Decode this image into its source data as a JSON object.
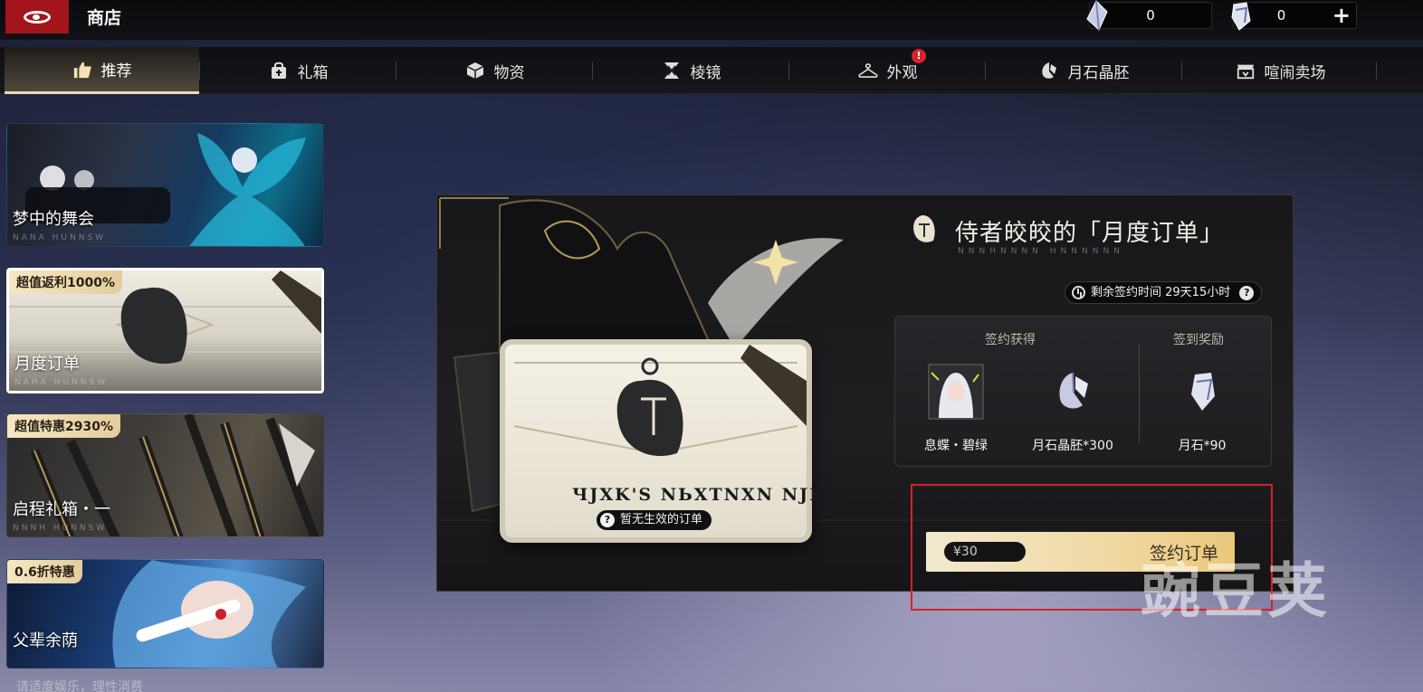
{
  "header": {
    "title": "商店",
    "currency": [
      {
        "icon": "moonstone-embryo-icon",
        "value": "0"
      },
      {
        "icon": "moonstone-icon",
        "value": "0",
        "add_label": "+"
      }
    ]
  },
  "tabs": [
    {
      "label": "推荐",
      "icon": "thumbs-up-icon",
      "active": true
    },
    {
      "label": "礼箱",
      "icon": "gift-bag-icon"
    },
    {
      "label": "物资",
      "icon": "cube-icon"
    },
    {
      "label": "棱镜",
      "icon": "prism-icon"
    },
    {
      "label": "外观",
      "icon": "hanger-icon",
      "badge": "!"
    },
    {
      "label": "月石晶胚",
      "icon": "crystal-icon"
    },
    {
      "label": "喧闹卖场",
      "icon": "market-icon"
    }
  ],
  "sidebar": {
    "items": [
      {
        "name": "梦中的舞会",
        "tag": "",
        "sub": "NANA HUNNSW"
      },
      {
        "name": "月度订单",
        "tag": "超值返利1000%",
        "sub": "NAHA HUNNSW"
      },
      {
        "name": "启程礼箱・一",
        "tag": "超值特惠2930%",
        "sub": "NNNH HUNNSW"
      },
      {
        "name": "父辈余荫",
        "tag": "0.6折特惠",
        "sub": ""
      }
    ],
    "bottom_note": "请适度娱乐，理性消费"
  },
  "panel": {
    "title": "侍者皎皎的「月度订单」",
    "subtitle": "NNNHNNNN HNNNNNN",
    "timer": "剩余签约时间 29天15小时",
    "timer_help": "?",
    "order_card": {
      "cipher": "ЧJXK'S NЬXTNXN NJЬS",
      "status": "暂无生效的订单",
      "status_help": "?"
    },
    "rewards": {
      "sign_label": "签约获得",
      "checkin_label": "签到奖励",
      "items": [
        {
          "label": "息蝶・碧绿",
          "icon": "character-portrait-icon"
        },
        {
          "label": "月石晶胚*300",
          "icon": "moonstone-embryo-icon"
        },
        {
          "label": "月石*90",
          "icon": "moonstone-icon"
        }
      ]
    },
    "button": {
      "price": "¥30",
      "label": "签约订单"
    }
  },
  "watermark": "豌豆荚",
  "colors": {
    "logo_red": "#a3141b",
    "accent_gold": "#e9c77c",
    "highlight_red": "#d7202a"
  }
}
